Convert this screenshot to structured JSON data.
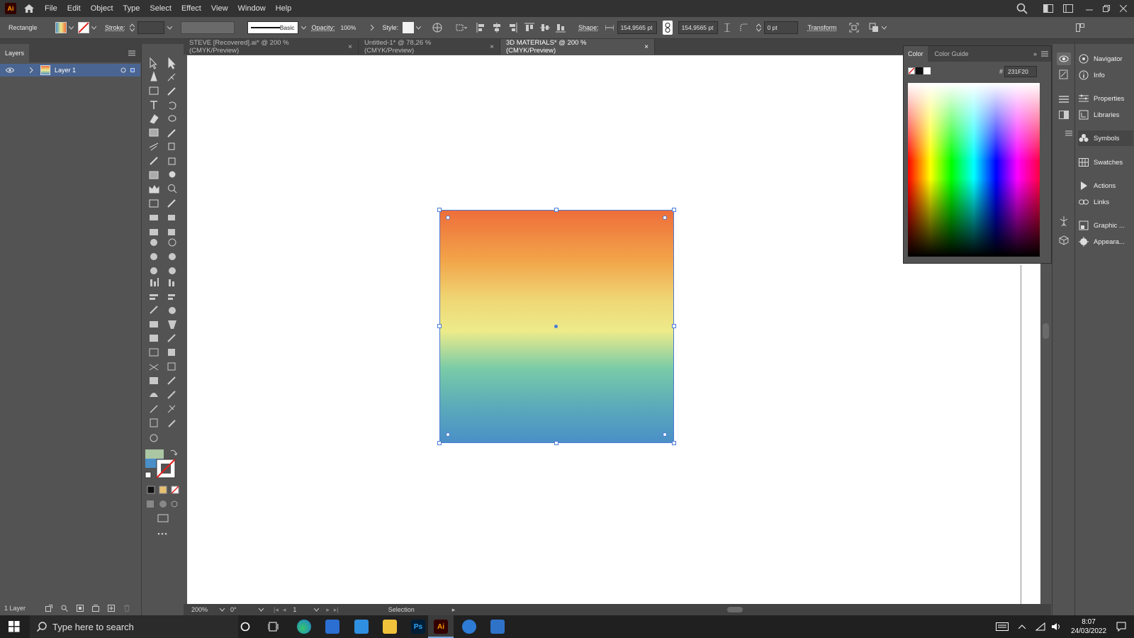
{
  "app": {
    "logo": "Ai"
  },
  "menu": [
    "File",
    "Edit",
    "Object",
    "Type",
    "Select",
    "Effect",
    "View",
    "Window",
    "Help"
  ],
  "control_bar": {
    "object_type": "Rectangle",
    "stroke_label": "Stroke:",
    "stroke_profile": "Basic",
    "opacity_label": "Opacity:",
    "opacity_value": "100%",
    "style_label": "Style:",
    "shape_label": "Shape:",
    "width_value": "154,9565 pt",
    "height_value": "154,9565 pt",
    "corner_value": "0 pt",
    "transform_label": "Transform"
  },
  "layers": {
    "tab": "Layers",
    "layer_name": "Layer 1",
    "footer_count": "1 Layer"
  },
  "documents": [
    {
      "title": "STEVE [Recovered].ai* @ 200 % (CMYK/Preview)",
      "close": "×"
    },
    {
      "title": "Untitled-1* @ 78,26 % (CMYK/Preview)",
      "close": "×"
    },
    {
      "title": "3D MATERIALS* @ 200 % (CMYK/Preview)",
      "close": "×"
    }
  ],
  "active_document_index": 2,
  "color_panel": {
    "tabs": [
      "Color",
      "Color Guide"
    ],
    "hex_label": "#",
    "hex_value": "231F20"
  },
  "dock": [
    "Navigator",
    "Info",
    "Properties",
    "Libraries",
    "Symbols",
    "Swatches",
    "Actions",
    "Links",
    "Graphic ...",
    "Appeara..."
  ],
  "status_bar": {
    "zoom": "200%",
    "rotation": "0°",
    "artboard": "1",
    "tool": "Selection"
  },
  "taskbar": {
    "search_placeholder": "Type here to search",
    "time": "8:07",
    "date": "24/03/2022"
  },
  "colors": {
    "gradient": [
      "#ee6d3a",
      "#edeb8a",
      "#4a8fc7"
    ],
    "accent": "#4a7bd6"
  }
}
